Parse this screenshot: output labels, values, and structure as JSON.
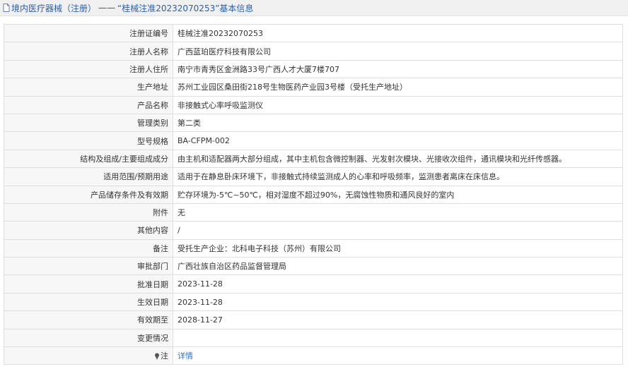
{
  "header": {
    "link": "境内医疗器械（注册）",
    "separator": "——",
    "title": "“桂械注准20232070253”基本信息"
  },
  "rows": [
    {
      "label": "注册证编号",
      "value": "桂械注准20232070253"
    },
    {
      "label": "注册人名称",
      "value": "广西蓝珀医疗科技有限公司"
    },
    {
      "label": "注册人住所",
      "value": "南宁市青秀区金洲路33号广西人才大厦7楼707"
    },
    {
      "label": "生产地址",
      "value": "苏州工业园区桑田街218号生物医药产业园3号楼（受托生产地址）"
    },
    {
      "label": "产品名称",
      "value": "非接触式心率呼吸监测仪"
    },
    {
      "label": "管理类别",
      "value": "第二类"
    },
    {
      "label": "型号规格",
      "value": "BA-CFPM-002"
    },
    {
      "label": "结构及组成/主要组成成分",
      "value": "由主机和适配器两大部分组成，其中主机包含微控制器、光发射次模块、光接收次组件，通讯模块和光纤传感器。"
    },
    {
      "label": "适用范围/预期用途",
      "value": "适用于在静息卧床环境下，非接触式持续监测成人的心率和呼吸频率，监测患者离床在床信息。"
    },
    {
      "label": "产品储存条件及有效期",
      "value": "贮存环境为-5℃~50℃，相对湿度不超过90%，无腐蚀性物质和通风良好的室内"
    },
    {
      "label": "附件",
      "value": "无"
    },
    {
      "label": "其他内容",
      "value": "/"
    },
    {
      "label": "备注",
      "value": "受托生产企业：北科电子科技（苏州）有限公司"
    },
    {
      "label": "审批部门",
      "value": "广西壮族自治区药品监督管理局"
    },
    {
      "label": "批准日期",
      "value": "2023-11-28"
    },
    {
      "label": "生效日期",
      "value": "2023-11-28"
    },
    {
      "label": "有效期至",
      "value": "2028-11-27"
    },
    {
      "label": "变更情况",
      "value": ""
    }
  ],
  "note_row": {
    "label": "注",
    "link": "详情"
  },
  "colors": {
    "link": "#2b72c9",
    "label_bg": "#f7f7f7",
    "border": "#dedede",
    "header_bg": "#f0f0f0"
  },
  "icons": {
    "header": "document-icon",
    "note": "pin-icon"
  }
}
